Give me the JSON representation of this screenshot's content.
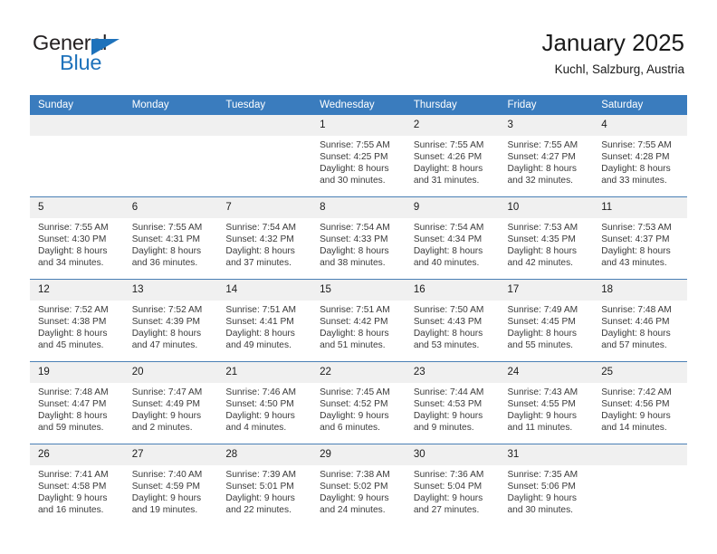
{
  "logo": {
    "word1": "General",
    "word2": "Blue",
    "triangle_color": "#1e72bb",
    "text_color": "#231f20"
  },
  "header": {
    "title": "January 2025",
    "subtitle": "Kuchl, Salzburg, Austria"
  },
  "colors": {
    "header_row_bg": "#3a7cbe",
    "header_row_text": "#ffffff",
    "daynum_bg": "#f0f0f0",
    "row_divider": "#4a7fb5",
    "body_text": "#3a3a3a"
  },
  "weekday_headers": [
    "Sunday",
    "Monday",
    "Tuesday",
    "Wednesday",
    "Thursday",
    "Friday",
    "Saturday"
  ],
  "weeks": [
    [
      {
        "day": "",
        "blank": true,
        "sunrise": "",
        "sunset": "",
        "daylight_line1": "",
        "daylight_line2": ""
      },
      {
        "day": "",
        "blank": true,
        "sunrise": "",
        "sunset": "",
        "daylight_line1": "",
        "daylight_line2": ""
      },
      {
        "day": "",
        "blank": true,
        "sunrise": "",
        "sunset": "",
        "daylight_line1": "",
        "daylight_line2": ""
      },
      {
        "day": "1",
        "sunrise": "Sunrise: 7:55 AM",
        "sunset": "Sunset: 4:25 PM",
        "daylight_line1": "Daylight: 8 hours",
        "daylight_line2": "and 30 minutes."
      },
      {
        "day": "2",
        "sunrise": "Sunrise: 7:55 AM",
        "sunset": "Sunset: 4:26 PM",
        "daylight_line1": "Daylight: 8 hours",
        "daylight_line2": "and 31 minutes."
      },
      {
        "day": "3",
        "sunrise": "Sunrise: 7:55 AM",
        "sunset": "Sunset: 4:27 PM",
        "daylight_line1": "Daylight: 8 hours",
        "daylight_line2": "and 32 minutes."
      },
      {
        "day": "4",
        "sunrise": "Sunrise: 7:55 AM",
        "sunset": "Sunset: 4:28 PM",
        "daylight_line1": "Daylight: 8 hours",
        "daylight_line2": "and 33 minutes."
      }
    ],
    [
      {
        "day": "5",
        "sunrise": "Sunrise: 7:55 AM",
        "sunset": "Sunset: 4:30 PM",
        "daylight_line1": "Daylight: 8 hours",
        "daylight_line2": "and 34 minutes."
      },
      {
        "day": "6",
        "sunrise": "Sunrise: 7:55 AM",
        "sunset": "Sunset: 4:31 PM",
        "daylight_line1": "Daylight: 8 hours",
        "daylight_line2": "and 36 minutes."
      },
      {
        "day": "7",
        "sunrise": "Sunrise: 7:54 AM",
        "sunset": "Sunset: 4:32 PM",
        "daylight_line1": "Daylight: 8 hours",
        "daylight_line2": "and 37 minutes."
      },
      {
        "day": "8",
        "sunrise": "Sunrise: 7:54 AM",
        "sunset": "Sunset: 4:33 PM",
        "daylight_line1": "Daylight: 8 hours",
        "daylight_line2": "and 38 minutes."
      },
      {
        "day": "9",
        "sunrise": "Sunrise: 7:54 AM",
        "sunset": "Sunset: 4:34 PM",
        "daylight_line1": "Daylight: 8 hours",
        "daylight_line2": "and 40 minutes."
      },
      {
        "day": "10",
        "sunrise": "Sunrise: 7:53 AM",
        "sunset": "Sunset: 4:35 PM",
        "daylight_line1": "Daylight: 8 hours",
        "daylight_line2": "and 42 minutes."
      },
      {
        "day": "11",
        "sunrise": "Sunrise: 7:53 AM",
        "sunset": "Sunset: 4:37 PM",
        "daylight_line1": "Daylight: 8 hours",
        "daylight_line2": "and 43 minutes."
      }
    ],
    [
      {
        "day": "12",
        "sunrise": "Sunrise: 7:52 AM",
        "sunset": "Sunset: 4:38 PM",
        "daylight_line1": "Daylight: 8 hours",
        "daylight_line2": "and 45 minutes."
      },
      {
        "day": "13",
        "sunrise": "Sunrise: 7:52 AM",
        "sunset": "Sunset: 4:39 PM",
        "daylight_line1": "Daylight: 8 hours",
        "daylight_line2": "and 47 minutes."
      },
      {
        "day": "14",
        "sunrise": "Sunrise: 7:51 AM",
        "sunset": "Sunset: 4:41 PM",
        "daylight_line1": "Daylight: 8 hours",
        "daylight_line2": "and 49 minutes."
      },
      {
        "day": "15",
        "sunrise": "Sunrise: 7:51 AM",
        "sunset": "Sunset: 4:42 PM",
        "daylight_line1": "Daylight: 8 hours",
        "daylight_line2": "and 51 minutes."
      },
      {
        "day": "16",
        "sunrise": "Sunrise: 7:50 AM",
        "sunset": "Sunset: 4:43 PM",
        "daylight_line1": "Daylight: 8 hours",
        "daylight_line2": "and 53 minutes."
      },
      {
        "day": "17",
        "sunrise": "Sunrise: 7:49 AM",
        "sunset": "Sunset: 4:45 PM",
        "daylight_line1": "Daylight: 8 hours",
        "daylight_line2": "and 55 minutes."
      },
      {
        "day": "18",
        "sunrise": "Sunrise: 7:48 AM",
        "sunset": "Sunset: 4:46 PM",
        "daylight_line1": "Daylight: 8 hours",
        "daylight_line2": "and 57 minutes."
      }
    ],
    [
      {
        "day": "19",
        "sunrise": "Sunrise: 7:48 AM",
        "sunset": "Sunset: 4:47 PM",
        "daylight_line1": "Daylight: 8 hours",
        "daylight_line2": "and 59 minutes."
      },
      {
        "day": "20",
        "sunrise": "Sunrise: 7:47 AM",
        "sunset": "Sunset: 4:49 PM",
        "daylight_line1": "Daylight: 9 hours",
        "daylight_line2": "and 2 minutes."
      },
      {
        "day": "21",
        "sunrise": "Sunrise: 7:46 AM",
        "sunset": "Sunset: 4:50 PM",
        "daylight_line1": "Daylight: 9 hours",
        "daylight_line2": "and 4 minutes."
      },
      {
        "day": "22",
        "sunrise": "Sunrise: 7:45 AM",
        "sunset": "Sunset: 4:52 PM",
        "daylight_line1": "Daylight: 9 hours",
        "daylight_line2": "and 6 minutes."
      },
      {
        "day": "23",
        "sunrise": "Sunrise: 7:44 AM",
        "sunset": "Sunset: 4:53 PM",
        "daylight_line1": "Daylight: 9 hours",
        "daylight_line2": "and 9 minutes."
      },
      {
        "day": "24",
        "sunrise": "Sunrise: 7:43 AM",
        "sunset": "Sunset: 4:55 PM",
        "daylight_line1": "Daylight: 9 hours",
        "daylight_line2": "and 11 minutes."
      },
      {
        "day": "25",
        "sunrise": "Sunrise: 7:42 AM",
        "sunset": "Sunset: 4:56 PM",
        "daylight_line1": "Daylight: 9 hours",
        "daylight_line2": "and 14 minutes."
      }
    ],
    [
      {
        "day": "26",
        "sunrise": "Sunrise: 7:41 AM",
        "sunset": "Sunset: 4:58 PM",
        "daylight_line1": "Daylight: 9 hours",
        "daylight_line2": "and 16 minutes."
      },
      {
        "day": "27",
        "sunrise": "Sunrise: 7:40 AM",
        "sunset": "Sunset: 4:59 PM",
        "daylight_line1": "Daylight: 9 hours",
        "daylight_line2": "and 19 minutes."
      },
      {
        "day": "28",
        "sunrise": "Sunrise: 7:39 AM",
        "sunset": "Sunset: 5:01 PM",
        "daylight_line1": "Daylight: 9 hours",
        "daylight_line2": "and 22 minutes."
      },
      {
        "day": "29",
        "sunrise": "Sunrise: 7:38 AM",
        "sunset": "Sunset: 5:02 PM",
        "daylight_line1": "Daylight: 9 hours",
        "daylight_line2": "and 24 minutes."
      },
      {
        "day": "30",
        "sunrise": "Sunrise: 7:36 AM",
        "sunset": "Sunset: 5:04 PM",
        "daylight_line1": "Daylight: 9 hours",
        "daylight_line2": "and 27 minutes."
      },
      {
        "day": "31",
        "sunrise": "Sunrise: 7:35 AM",
        "sunset": "Sunset: 5:06 PM",
        "daylight_line1": "Daylight: 9 hours",
        "daylight_line2": "and 30 minutes."
      },
      {
        "day": "",
        "blank": true,
        "sunrise": "",
        "sunset": "",
        "daylight_line1": "",
        "daylight_line2": ""
      }
    ]
  ]
}
